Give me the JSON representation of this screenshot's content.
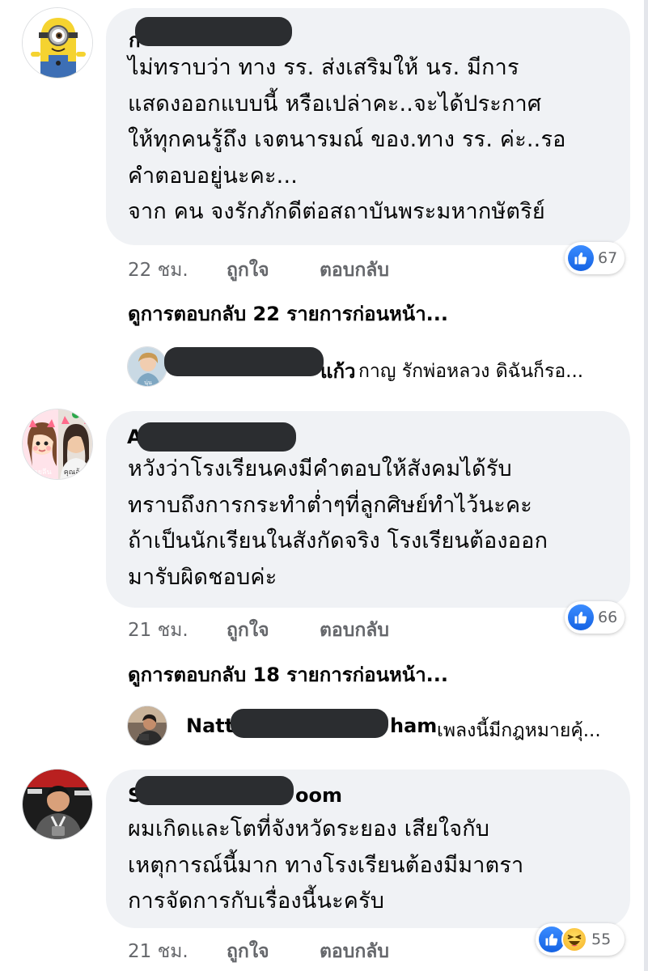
{
  "comments": [
    {
      "author_partial": "ก",
      "body": "ไม่ทราบว่า ทาง รร. ส่งเสริมให้ นร. มีการ\nแสดงออกแบบนี้ หรือเปล่าคะ..จะได้ประกาศ\nให้ทุกคนรู้ถึง เจตนารมณ์ ของ.ทาง รร. ค่ะ..รอ\nคำตอบอยู่นะคะ...\nจาก คน จงรักภักดีต่อสถาบันพระมหากษัตริย์",
      "time": "22 ชม.",
      "like_label": "ถูกใจ",
      "reply_label": "ตอบกลับ",
      "reaction_count": "67",
      "reactions": [
        "like-icon"
      ],
      "view_more": "ดูการตอบกลับ 22 รายการก่อนหน้า...",
      "reply": {
        "name_suffix": "แก้ว",
        "preview": "กาญ รักพ่อหลวง ดิฉันก็รอ..."
      }
    },
    {
      "author_partial": "A",
      "body": "หวังว่าโรงเรียนคงมีคำตอบให้สังคมได้รับ\nทราบถึงการกระทำต่ำๆที่ลูกศิษย์ทำไว้นะคะ\nถ้าเป็นนักเรียนในสังกัดจริง โรงเรียนต้องออก\nมารับผิดชอบค่ะ",
      "time": "21 ชม.",
      "like_label": "ถูกใจ",
      "reply_label": "ตอบกลับ",
      "reaction_count": "66",
      "reactions": [
        "like-icon"
      ],
      "view_more": "ดูการตอบกลับ 18 รายการก่อนหน้า...",
      "reply": {
        "name_prefix": "Natt",
        "name_suffix": "ham",
        "preview": "เพลงนี้มีกฎหมายคุ้..."
      }
    },
    {
      "author_prefix": "S",
      "author_suffix": "oom",
      "body": "ผมเกิดและโตที่จังหวัดระยอง เสียใจกับ\nเหตุการณ์นี้มาก ทางโรงเรียนต้องมีมาตรา\nการจัดการกับเรื่องนี้นะครับ",
      "time": "21 ชม.",
      "like_label": "ถูกใจ",
      "reply_label": "ตอบกลับ",
      "reaction_count": "55",
      "reactions": [
        "like-icon",
        "haha-icon"
      ]
    }
  ],
  "avatar_labels": {
    "reply1": "นุ่น",
    "comment2_left": "อ้ายลีน",
    "comment2_right": "คุณอ้อย"
  },
  "colors": {
    "bubble": "#f0f2f5",
    "meta_text": "#65676b",
    "like_blue": "#1877f2",
    "redaction": "#2b2d30"
  }
}
